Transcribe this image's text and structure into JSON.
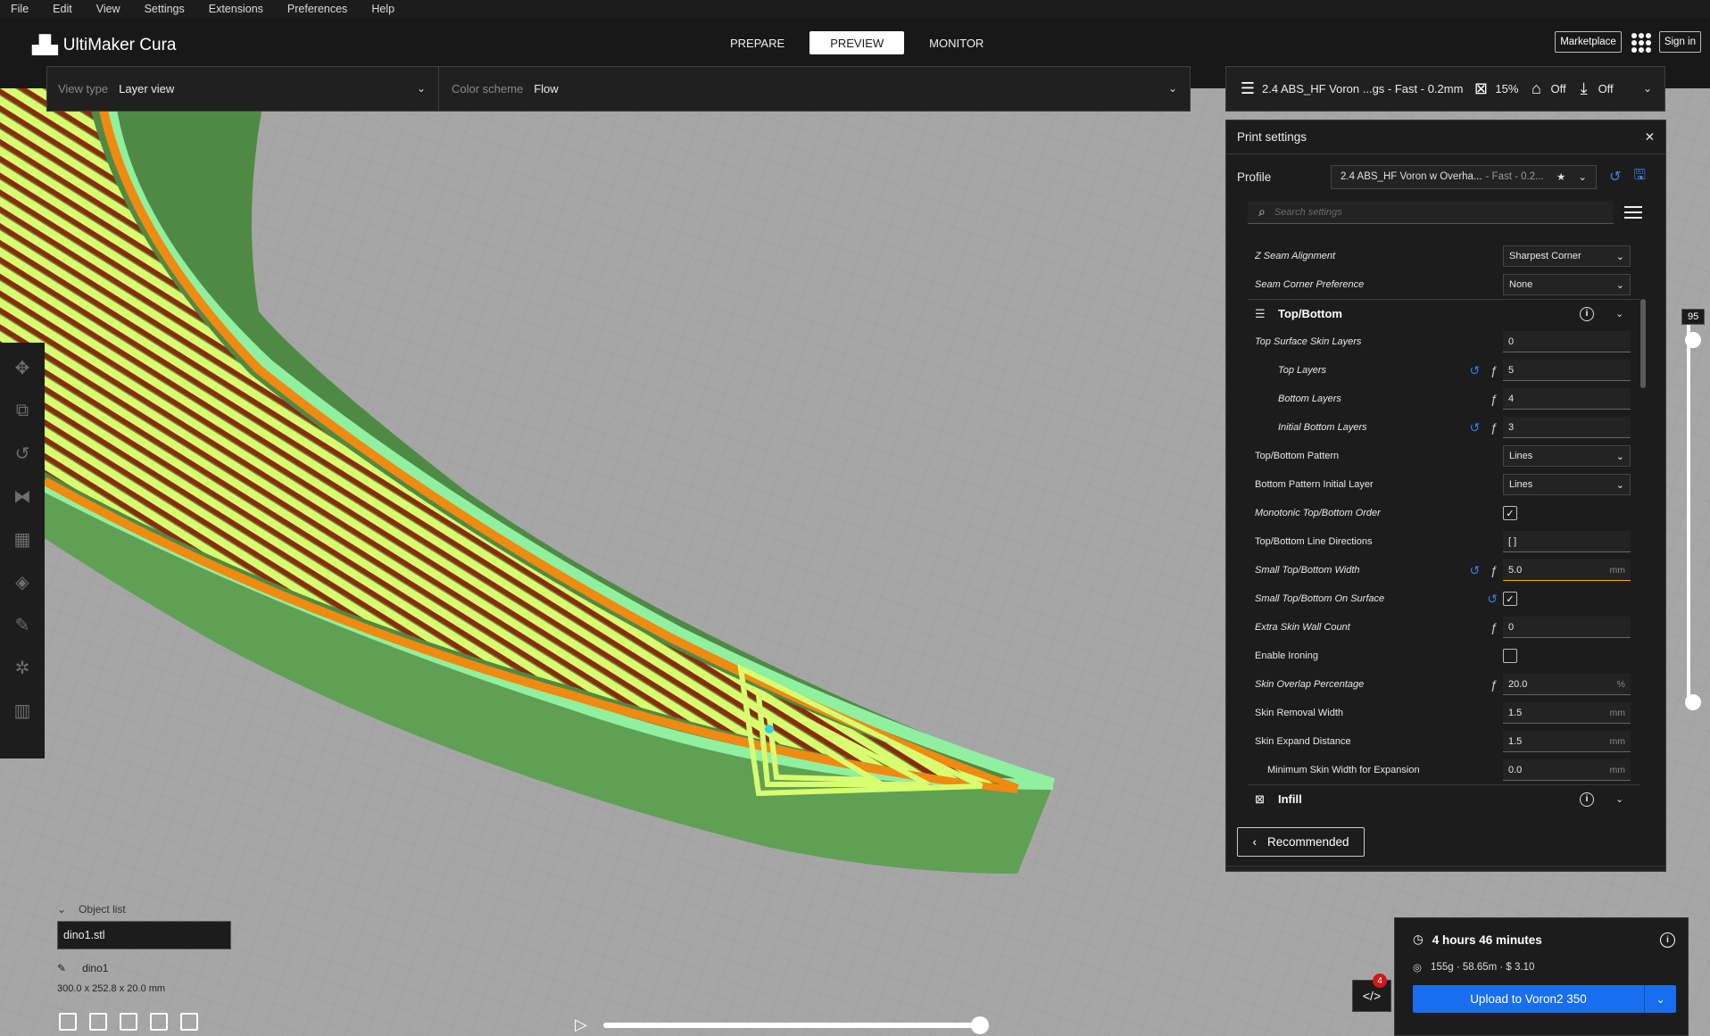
{
  "menu": [
    "File",
    "Edit",
    "View",
    "Settings",
    "Extensions",
    "Preferences",
    "Help"
  ],
  "app": {
    "name": "UltiMaker Cura"
  },
  "stages": [
    {
      "label": "PREPARE",
      "active": false
    },
    {
      "label": "PREVIEW",
      "active": true
    },
    {
      "label": "MONITOR",
      "active": false
    }
  ],
  "header": {
    "marketplace": "Marketplace",
    "signin": "Sign in"
  },
  "toolbar": {
    "view_type_label": "View type",
    "view_type_value": "Layer view",
    "color_scheme_label": "Color scheme",
    "color_scheme_value": "Flow",
    "profile_summary": "2.4 ABS_HF Voron ...gs - Fast - 0.2mm",
    "infill": "15%",
    "support": "Off",
    "adhesion": "Off"
  },
  "print_settings": {
    "title": "Print settings",
    "profile_label": "Profile",
    "profile_name": "2.4 ABS_HF Voron w Overha...",
    "profile_suffix": "- Fast - 0.2...",
    "search_placeholder": "Search settings",
    "rows": [
      {
        "label": "Z Seam Alignment",
        "value": "Sharpest Corner",
        "type": "dropdown",
        "italic": true
      },
      {
        "label": "Seam Corner Preference",
        "value": "None",
        "type": "dropdown",
        "italic": true
      }
    ],
    "category_top_bottom": "Top/Bottom",
    "top_bottom_rows": [
      {
        "label": "Top Surface Skin Layers",
        "value": "0",
        "italic": true
      },
      {
        "label": "Top Layers",
        "value": "5",
        "italic": true,
        "indent": true,
        "reset": true,
        "fx": true
      },
      {
        "label": "Bottom Layers",
        "value": "4",
        "italic": true,
        "indent": true,
        "fx": true
      },
      {
        "label": "Initial Bottom Layers",
        "value": "3",
        "italic": true,
        "indent": true,
        "reset": true,
        "fx": true
      },
      {
        "label": "Top/Bottom Pattern",
        "value": "Lines",
        "type": "dropdown"
      },
      {
        "label": "Bottom Pattern Initial Layer",
        "value": "Lines",
        "type": "dropdown"
      },
      {
        "label": "Monotonic Top/Bottom Order",
        "type": "checkbox",
        "checked": true,
        "italic": true
      },
      {
        "label": "Top/Bottom Line Directions",
        "value": "[ ]"
      },
      {
        "label": "Small Top/Bottom Width",
        "value": "5.0",
        "unit": "mm",
        "italic": true,
        "reset": true,
        "fx": true,
        "highlight": true
      },
      {
        "label": "Small Top/Bottom On Surface",
        "type": "checkbox",
        "checked": true,
        "italic": true,
        "reset": true
      },
      {
        "label": "Extra Skin Wall Count",
        "value": "0",
        "italic": true,
        "fx": true
      },
      {
        "label": "Enable Ironing",
        "type": "checkbox",
        "checked": false
      },
      {
        "label": "Skin Overlap Percentage",
        "value": "20.0",
        "unit": "%",
        "italic": true,
        "fx": true
      },
      {
        "label": "Skin Removal Width",
        "value": "1.5",
        "unit": "mm"
      },
      {
        "label": "Skin Expand Distance",
        "value": "1.5",
        "unit": "mm"
      },
      {
        "label": "Minimum Skin Width for Expansion",
        "value": "0.0",
        "unit": "mm",
        "indent2": true
      }
    ],
    "category_infill": "Infill",
    "recommended_button": "Recommended"
  },
  "layer_slider": {
    "current_layer": "95"
  },
  "object_list": {
    "header": "Object list",
    "file": "dino1.stl",
    "object_name": "dino1",
    "dimensions": "300.0 x 252.8 x 20.0 mm"
  },
  "output": {
    "print_time": "4 hours 46 minutes",
    "material": "155g · 58.65m · $ 3.10",
    "upload_button": "Upload to Voron2 350",
    "badge_count": "4"
  },
  "colors": {
    "accent_blue": "#196ef0",
    "model_green": "#5a9e50",
    "wall_light": "#8ff0a0",
    "skin_yellow": "#d8ff70",
    "inner_orange": "#f08a10"
  },
  "icons": {
    "infill": "infill-icon",
    "support": "support-icon",
    "adhesion": "adhesion-icon",
    "clock": "clock-icon",
    "spool": "spool-icon"
  }
}
